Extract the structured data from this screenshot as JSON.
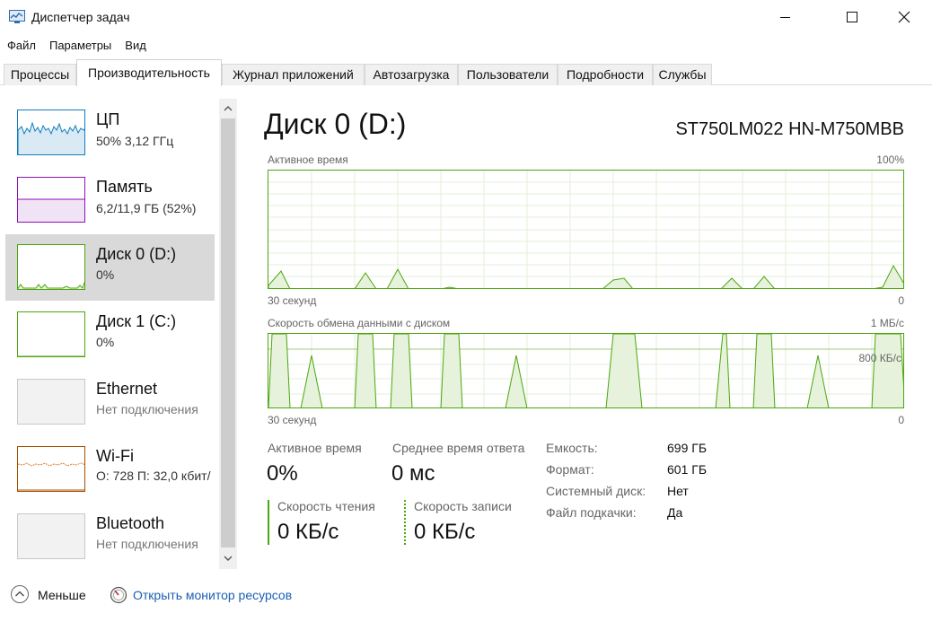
{
  "window": {
    "title": "Диспетчер задач",
    "icon": "task-manager-icon"
  },
  "menu": [
    "Файл",
    "Параметры",
    "Вид"
  ],
  "tabs": [
    {
      "label": "Процессы",
      "active": false
    },
    {
      "label": "Производительность",
      "active": true
    },
    {
      "label": "Журнал приложений",
      "active": false
    },
    {
      "label": "Автозагрузка",
      "active": false
    },
    {
      "label": "Пользователи",
      "active": false
    },
    {
      "label": "Подробности",
      "active": false
    },
    {
      "label": "Службы",
      "active": false
    }
  ],
  "sidebar": {
    "items": [
      {
        "name": "ЦП",
        "sub": "50% 3,12 ГГц",
        "color": "#117dbb"
      },
      {
        "name": "Память",
        "sub": "6,2/11,9 ГБ (52%)",
        "color": "#8b12ae"
      },
      {
        "name": "Диск 0 (D:)",
        "sub": "0%",
        "color": "#4da60c",
        "active": true
      },
      {
        "name": "Диск 1 (C:)",
        "sub": "0%",
        "color": "#4da60c"
      },
      {
        "name": "Ethernet",
        "sub": "Нет подключения",
        "color": "#a74f01"
      },
      {
        "name": "Wi-Fi",
        "sub": "О: 728  П: 32,0 кбит/",
        "color": "#a74f01"
      },
      {
        "name": "Bluetooth",
        "sub": "Нет подключения",
        "color": "#a74f01"
      }
    ]
  },
  "main": {
    "title": "Диск 0 (D:)",
    "model": "ST750LM022 HN-M750MBB",
    "accent": "#4da60c",
    "graph1": {
      "label": "Активное время",
      "max": "100%",
      "time": "30 секунд",
      "min": "0"
    },
    "graph2": {
      "label": "Скорость обмена данными с диском",
      "max": "1 МБ/с",
      "mark": "800 КБ/с",
      "time": "30 секунд",
      "min": "0"
    },
    "stats": {
      "active_label": "Активное время",
      "active_value": "0%",
      "response_label": "Среднее время ответа",
      "response_value": "0 мс",
      "read_label": "Скорость чтения",
      "read_value": "0 КБ/с",
      "write_label": "Скорость записи",
      "write_value": "0 КБ/с"
    },
    "props": [
      {
        "label": "Емкость:",
        "value": "699 ГБ"
      },
      {
        "label": "Формат:",
        "value": "601 ГБ"
      },
      {
        "label": "Системный диск:",
        "value": "Нет"
      },
      {
        "label": "Файл подкачки:",
        "value": "Да"
      }
    ]
  },
  "footer": {
    "less": "Меньше",
    "monitor": "Открыть монитор ресурсов"
  }
}
